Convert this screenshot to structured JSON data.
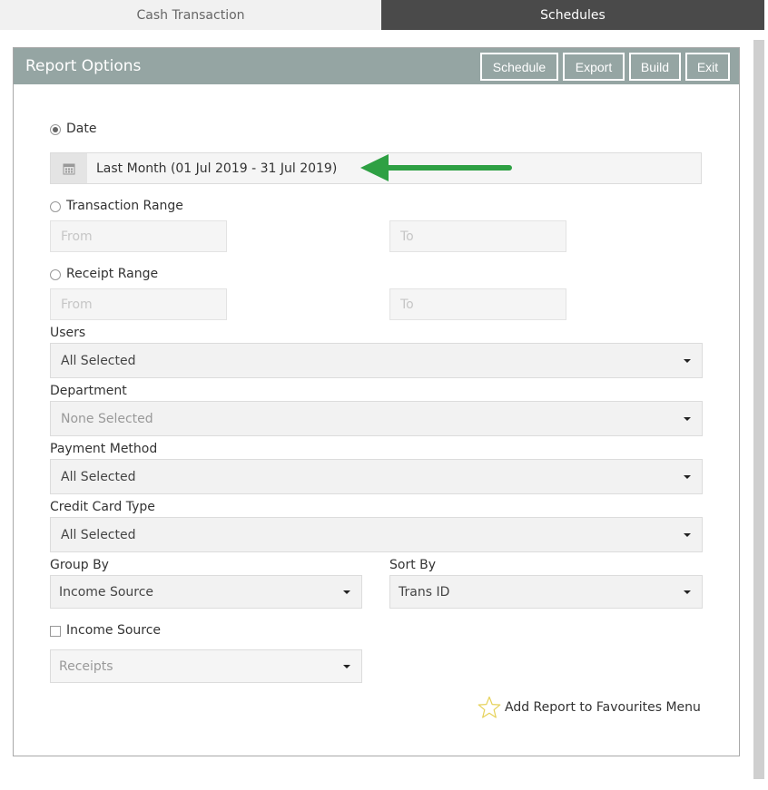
{
  "tabs": [
    {
      "label": "Cash Transaction",
      "active": false
    },
    {
      "label": "Schedules",
      "active": true
    }
  ],
  "panel": {
    "title": "Report Options",
    "buttons": {
      "schedule": "Schedule",
      "export": "Export",
      "build": "Build",
      "exit": "Exit"
    }
  },
  "date": {
    "label": "Date",
    "selected": true,
    "value": "Last Month (01 Jul 2019 - 31 Jul 2019)",
    "icon": "calendar-icon"
  },
  "transaction_range": {
    "label": "Transaction Range",
    "from_placeholder": "From",
    "to_placeholder": "To"
  },
  "receipt_range": {
    "label": "Receipt Range",
    "from_placeholder": "From",
    "to_placeholder": "To"
  },
  "users": {
    "label": "Users",
    "value": "All Selected"
  },
  "department": {
    "label": "Department",
    "value": "None Selected"
  },
  "payment_method": {
    "label": "Payment Method",
    "value": "All Selected"
  },
  "credit_card_type": {
    "label": "Credit Card Type",
    "value": "All Selected"
  },
  "group_by": {
    "label": "Group By",
    "value": "Income Source"
  },
  "sort_by": {
    "label": "Sort By",
    "value": "Trans ID"
  },
  "income_source": {
    "label": "Income Source",
    "checked": false,
    "value": "Receipts"
  },
  "favourites": {
    "label": "Add Report to Favourites Menu",
    "icon": "star-icon"
  },
  "colors": {
    "header": "#95a5a3",
    "active_tab": "#4a4a4a",
    "arrow": "#2ea043"
  }
}
